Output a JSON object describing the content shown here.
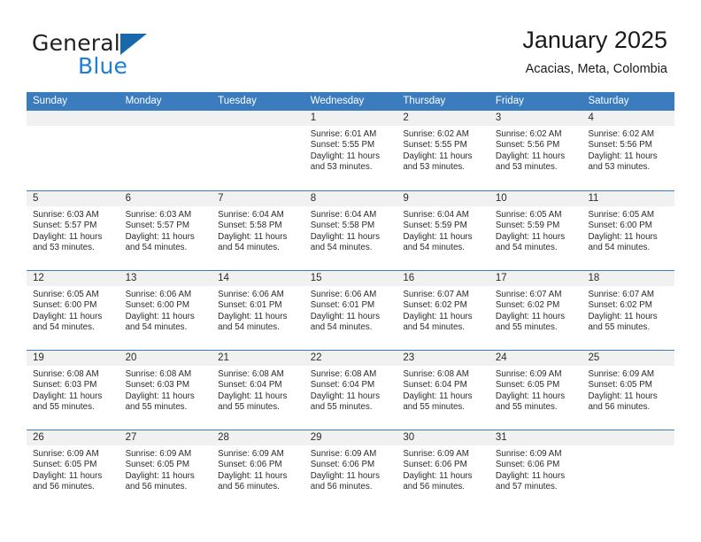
{
  "brand": {
    "name_part1": "General",
    "name_part2": "Blue",
    "logo_icon": "triangle-logo-icon"
  },
  "header": {
    "title": "January 2025",
    "subtitle": "Acacias, Meta, Colombia"
  },
  "theme": {
    "header_blue": "#3a7cbe",
    "band_gray": "#f1f1f1",
    "brand_blue": "#1c7fd4",
    "text_dark": "#2b2b2b"
  },
  "weekdays": [
    "Sunday",
    "Monday",
    "Tuesday",
    "Wednesday",
    "Thursday",
    "Friday",
    "Saturday"
  ],
  "weeks": [
    [
      {
        "empty": true
      },
      {
        "empty": true
      },
      {
        "empty": true
      },
      {
        "day": "1",
        "sunrise": "Sunrise: 6:01 AM",
        "sunset": "Sunset: 5:55 PM",
        "daylight1": "Daylight: 11 hours",
        "daylight2": "and 53 minutes."
      },
      {
        "day": "2",
        "sunrise": "Sunrise: 6:02 AM",
        "sunset": "Sunset: 5:55 PM",
        "daylight1": "Daylight: 11 hours",
        "daylight2": "and 53 minutes."
      },
      {
        "day": "3",
        "sunrise": "Sunrise: 6:02 AM",
        "sunset": "Sunset: 5:56 PM",
        "daylight1": "Daylight: 11 hours",
        "daylight2": "and 53 minutes."
      },
      {
        "day": "4",
        "sunrise": "Sunrise: 6:02 AM",
        "sunset": "Sunset: 5:56 PM",
        "daylight1": "Daylight: 11 hours",
        "daylight2": "and 53 minutes."
      }
    ],
    [
      {
        "day": "5",
        "sunrise": "Sunrise: 6:03 AM",
        "sunset": "Sunset: 5:57 PM",
        "daylight1": "Daylight: 11 hours",
        "daylight2": "and 53 minutes."
      },
      {
        "day": "6",
        "sunrise": "Sunrise: 6:03 AM",
        "sunset": "Sunset: 5:57 PM",
        "daylight1": "Daylight: 11 hours",
        "daylight2": "and 54 minutes."
      },
      {
        "day": "7",
        "sunrise": "Sunrise: 6:04 AM",
        "sunset": "Sunset: 5:58 PM",
        "daylight1": "Daylight: 11 hours",
        "daylight2": "and 54 minutes."
      },
      {
        "day": "8",
        "sunrise": "Sunrise: 6:04 AM",
        "sunset": "Sunset: 5:58 PM",
        "daylight1": "Daylight: 11 hours",
        "daylight2": "and 54 minutes."
      },
      {
        "day": "9",
        "sunrise": "Sunrise: 6:04 AM",
        "sunset": "Sunset: 5:59 PM",
        "daylight1": "Daylight: 11 hours",
        "daylight2": "and 54 minutes."
      },
      {
        "day": "10",
        "sunrise": "Sunrise: 6:05 AM",
        "sunset": "Sunset: 5:59 PM",
        "daylight1": "Daylight: 11 hours",
        "daylight2": "and 54 minutes."
      },
      {
        "day": "11",
        "sunrise": "Sunrise: 6:05 AM",
        "sunset": "Sunset: 6:00 PM",
        "daylight1": "Daylight: 11 hours",
        "daylight2": "and 54 minutes."
      }
    ],
    [
      {
        "day": "12",
        "sunrise": "Sunrise: 6:05 AM",
        "sunset": "Sunset: 6:00 PM",
        "daylight1": "Daylight: 11 hours",
        "daylight2": "and 54 minutes."
      },
      {
        "day": "13",
        "sunrise": "Sunrise: 6:06 AM",
        "sunset": "Sunset: 6:00 PM",
        "daylight1": "Daylight: 11 hours",
        "daylight2": "and 54 minutes."
      },
      {
        "day": "14",
        "sunrise": "Sunrise: 6:06 AM",
        "sunset": "Sunset: 6:01 PM",
        "daylight1": "Daylight: 11 hours",
        "daylight2": "and 54 minutes."
      },
      {
        "day": "15",
        "sunrise": "Sunrise: 6:06 AM",
        "sunset": "Sunset: 6:01 PM",
        "daylight1": "Daylight: 11 hours",
        "daylight2": "and 54 minutes."
      },
      {
        "day": "16",
        "sunrise": "Sunrise: 6:07 AM",
        "sunset": "Sunset: 6:02 PM",
        "daylight1": "Daylight: 11 hours",
        "daylight2": "and 54 minutes."
      },
      {
        "day": "17",
        "sunrise": "Sunrise: 6:07 AM",
        "sunset": "Sunset: 6:02 PM",
        "daylight1": "Daylight: 11 hours",
        "daylight2": "and 55 minutes."
      },
      {
        "day": "18",
        "sunrise": "Sunrise: 6:07 AM",
        "sunset": "Sunset: 6:02 PM",
        "daylight1": "Daylight: 11 hours",
        "daylight2": "and 55 minutes."
      }
    ],
    [
      {
        "day": "19",
        "sunrise": "Sunrise: 6:08 AM",
        "sunset": "Sunset: 6:03 PM",
        "daylight1": "Daylight: 11 hours",
        "daylight2": "and 55 minutes."
      },
      {
        "day": "20",
        "sunrise": "Sunrise: 6:08 AM",
        "sunset": "Sunset: 6:03 PM",
        "daylight1": "Daylight: 11 hours",
        "daylight2": "and 55 minutes."
      },
      {
        "day": "21",
        "sunrise": "Sunrise: 6:08 AM",
        "sunset": "Sunset: 6:04 PM",
        "daylight1": "Daylight: 11 hours",
        "daylight2": "and 55 minutes."
      },
      {
        "day": "22",
        "sunrise": "Sunrise: 6:08 AM",
        "sunset": "Sunset: 6:04 PM",
        "daylight1": "Daylight: 11 hours",
        "daylight2": "and 55 minutes."
      },
      {
        "day": "23",
        "sunrise": "Sunrise: 6:08 AM",
        "sunset": "Sunset: 6:04 PM",
        "daylight1": "Daylight: 11 hours",
        "daylight2": "and 55 minutes."
      },
      {
        "day": "24",
        "sunrise": "Sunrise: 6:09 AM",
        "sunset": "Sunset: 6:05 PM",
        "daylight1": "Daylight: 11 hours",
        "daylight2": "and 55 minutes."
      },
      {
        "day": "25",
        "sunrise": "Sunrise: 6:09 AM",
        "sunset": "Sunset: 6:05 PM",
        "daylight1": "Daylight: 11 hours",
        "daylight2": "and 56 minutes."
      }
    ],
    [
      {
        "day": "26",
        "sunrise": "Sunrise: 6:09 AM",
        "sunset": "Sunset: 6:05 PM",
        "daylight1": "Daylight: 11 hours",
        "daylight2": "and 56 minutes."
      },
      {
        "day": "27",
        "sunrise": "Sunrise: 6:09 AM",
        "sunset": "Sunset: 6:05 PM",
        "daylight1": "Daylight: 11 hours",
        "daylight2": "and 56 minutes."
      },
      {
        "day": "28",
        "sunrise": "Sunrise: 6:09 AM",
        "sunset": "Sunset: 6:06 PM",
        "daylight1": "Daylight: 11 hours",
        "daylight2": "and 56 minutes."
      },
      {
        "day": "29",
        "sunrise": "Sunrise: 6:09 AM",
        "sunset": "Sunset: 6:06 PM",
        "daylight1": "Daylight: 11 hours",
        "daylight2": "and 56 minutes."
      },
      {
        "day": "30",
        "sunrise": "Sunrise: 6:09 AM",
        "sunset": "Sunset: 6:06 PM",
        "daylight1": "Daylight: 11 hours",
        "daylight2": "and 56 minutes."
      },
      {
        "day": "31",
        "sunrise": "Sunrise: 6:09 AM",
        "sunset": "Sunset: 6:06 PM",
        "daylight1": "Daylight: 11 hours",
        "daylight2": "and 57 minutes."
      },
      {
        "empty": true
      }
    ]
  ]
}
